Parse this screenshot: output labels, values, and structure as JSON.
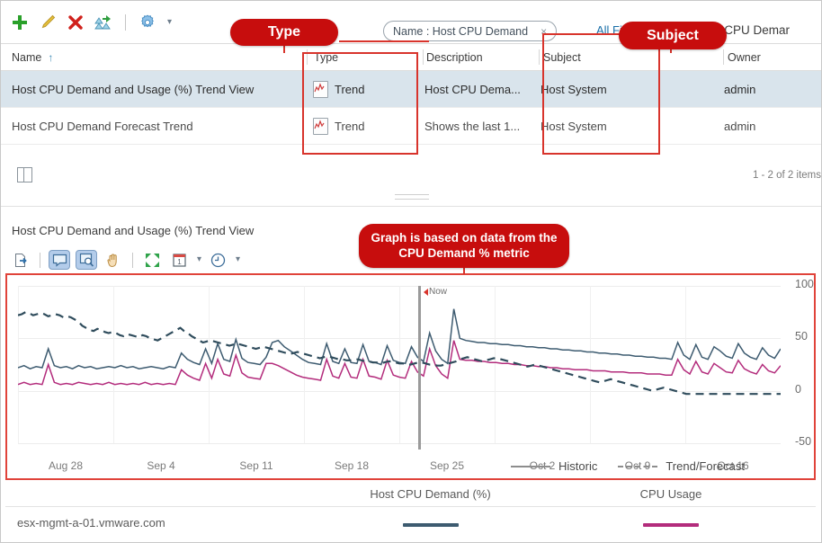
{
  "toolbar": {
    "icons": [
      {
        "name": "add-icon",
        "glyph": "+"
      },
      {
        "name": "edit-pencil-icon",
        "glyph": "/"
      },
      {
        "name": "delete-icon",
        "glyph": "X"
      },
      {
        "name": "clone-icon",
        "glyph": "clone"
      },
      {
        "name": "gear-icon",
        "glyph": "gear"
      }
    ],
    "filter_chip": "Name : Host CPU Demand",
    "filter_chip_close": "×",
    "all_filters_label": "All Fi",
    "breadcrumb_tail": "st CPU Demar"
  },
  "table": {
    "columns": [
      "Name",
      "Type",
      "Description",
      "Subject",
      "Owner"
    ],
    "sort_indicator": "↑",
    "rows": [
      {
        "name": "Host CPU Demand and Usage (%) Trend View",
        "type": "Trend",
        "description": "Host CPU Dema...",
        "subject": "Host System",
        "owner": "admin",
        "selected": true
      },
      {
        "name": "Host CPU Demand Forecast Trend",
        "type": "Trend",
        "description": "Shows the last 1...",
        "subject": "Host System",
        "owner": "admin",
        "selected": false
      }
    ],
    "pagination": "1 - 2 of 2 items"
  },
  "panel": {
    "title": "Host CPU Demand and Usage (%) Trend View",
    "tools": [
      {
        "name": "export-icon",
        "active": false
      },
      {
        "name": "tooltip-select-icon",
        "active": true
      },
      {
        "name": "zoom-select-icon",
        "active": true
      },
      {
        "name": "pan-hand-icon",
        "active": false
      },
      {
        "name": "fit-screen-icon",
        "active": false
      },
      {
        "name": "date-range-icon",
        "active": false
      },
      {
        "name": "time-range-icon",
        "active": false
      }
    ]
  },
  "chart_data": {
    "type": "line",
    "title": "Host CPU Demand and Usage (%) Trend View",
    "xlabel": "",
    "ylabel": "",
    "ylim": [
      -50,
      100
    ],
    "yticks": [
      100,
      50,
      0,
      -50
    ],
    "xticks": [
      "Aug 28",
      "Sep 4",
      "Sep 11",
      "Sep 18",
      "Sep 25",
      "Oct 2",
      "Oct 9",
      "Oct 16"
    ],
    "grid": true,
    "now_marker": "Now",
    "legend_position": "bottom-right",
    "legend": [
      {
        "label": "Historic",
        "style": "solid"
      },
      {
        "label": "Trend/Forecast",
        "style": "dashed"
      }
    ],
    "series": [
      {
        "name": "Host CPU Demand (%)",
        "color": "#3d5b70",
        "style": "solid",
        "values": [
          22,
          24,
          21,
          23,
          22,
          40,
          24,
          22,
          23,
          21,
          24,
          22,
          23,
          21,
          22,
          23,
          22,
          24,
          22,
          23,
          21,
          22,
          23,
          22,
          21,
          23,
          22,
          36,
          30,
          27,
          25,
          40,
          26,
          45,
          30,
          28,
          49,
          31,
          27,
          26,
          25,
          32,
          46,
          48,
          42,
          38,
          34,
          30,
          27,
          26,
          25,
          45,
          28,
          26,
          40,
          27,
          26,
          44,
          28,
          27,
          25,
          43,
          29,
          27,
          26,
          42,
          32,
          28,
          55,
          38,
          30,
          26,
          78,
          50,
          48,
          47,
          46,
          46,
          45,
          45,
          44,
          44,
          43,
          43,
          42,
          42,
          41,
          41,
          40,
          40,
          39,
          39,
          38,
          38,
          37,
          37,
          36,
          36,
          35,
          35,
          34,
          34,
          33,
          33,
          32,
          32,
          31,
          31,
          30,
          46,
          34,
          30,
          44,
          32,
          30,
          42,
          38,
          33,
          31,
          45,
          36,
          32,
          30,
          41,
          34,
          31,
          40
        ]
      },
      {
        "name": "CPU Usage",
        "color": "#b32c7c",
        "style": "solid",
        "values": [
          6,
          8,
          6,
          7,
          6,
          25,
          8,
          6,
          7,
          6,
          8,
          7,
          6,
          7,
          6,
          8,
          6,
          7,
          6,
          7,
          6,
          8,
          6,
          7,
          6,
          7,
          6,
          20,
          15,
          12,
          10,
          26,
          12,
          30,
          16,
          14,
          34,
          17,
          13,
          12,
          11,
          26,
          26,
          24,
          21,
          18,
          15,
          13,
          12,
          11,
          10,
          30,
          14,
          12,
          26,
          13,
          12,
          30,
          14,
          13,
          11,
          29,
          15,
          13,
          12,
          28,
          18,
          14,
          40,
          24,
          16,
          12,
          48,
          30,
          29,
          29,
          28,
          28,
          27,
          27,
          26,
          26,
          25,
          25,
          24,
          24,
          23,
          23,
          22,
          22,
          21,
          21,
          20,
          20,
          20,
          19,
          19,
          19,
          18,
          18,
          18,
          17,
          17,
          17,
          16,
          16,
          16,
          15,
          15,
          30,
          20,
          16,
          28,
          18,
          16,
          26,
          22,
          18,
          17,
          29,
          21,
          18,
          16,
          25,
          19,
          17,
          24
        ]
      },
      {
        "name": "Trend/Forecast",
        "color": "#2f4c5c",
        "style": "dashed",
        "values": [
          72,
          73,
          75,
          74,
          72,
          73,
          74,
          73,
          71,
          72,
          73,
          72,
          70,
          71,
          70,
          68,
          66,
          62,
          60,
          58,
          57,
          59,
          58,
          56,
          55,
          56,
          55,
          53,
          52,
          54,
          53,
          52,
          51,
          53,
          52,
          50,
          49,
          48,
          50,
          52,
          54,
          56,
          58,
          60,
          57,
          55,
          52,
          50,
          48,
          46,
          47,
          48,
          47,
          46,
          45,
          44,
          43,
          44,
          45,
          44,
          43,
          42,
          41,
          40,
          41,
          42,
          41,
          40,
          39,
          38,
          37,
          36,
          35,
          36,
          37,
          36,
          35,
          34,
          33,
          32,
          31,
          32,
          33,
          32,
          31,
          30,
          30,
          29,
          29,
          30,
          30,
          29,
          28,
          28,
          27,
          27,
          26,
          27,
          28,
          28,
          27,
          26,
          26,
          25,
          25,
          26,
          27,
          27,
          26,
          25,
          25,
          24,
          24,
          25,
          26,
          27,
          28,
          30,
          31,
          32,
          31,
          30,
          29,
          28,
          29,
          30,
          31,
          31,
          30,
          29,
          28,
          27,
          26,
          25,
          24,
          23,
          24,
          25,
          24,
          23,
          22,
          21,
          20,
          19,
          18,
          17,
          16,
          15,
          14,
          13,
          12,
          11,
          10,
          9,
          8,
          9,
          10,
          11,
          10,
          9,
          8,
          7,
          6,
          5,
          4,
          3,
          2,
          1,
          0,
          1,
          2,
          3,
          2,
          1,
          0,
          -1,
          -2,
          -3,
          -3,
          -3,
          -3,
          -3,
          -3,
          -3,
          -3,
          -3,
          -3,
          -3,
          -3,
          -3,
          -3,
          -3,
          -3,
          -3,
          -3,
          -3,
          -3,
          -3,
          -3,
          -3,
          -3,
          -3,
          -3
        ]
      }
    ]
  },
  "metric_legend": {
    "headers": [
      "",
      "Host CPU Demand (%)",
      "CPU Usage"
    ],
    "row_label": "esx-mgmt-a-01.vmware.com",
    "swatches": [
      "#3d5b70",
      "#b32c7c"
    ]
  },
  "annotations": {
    "callouts": [
      {
        "name": "type-callout",
        "text": "Type"
      },
      {
        "name": "subject-callout",
        "text": "Subject"
      },
      {
        "name": "graph-source-callout",
        "text": "Graph is based on data from the CPU Demand % metric"
      }
    ]
  },
  "colors": {
    "annotation_red": "#d8342c",
    "callout_red": "#c70d0d",
    "demand_line": "#3d5b70",
    "usage_line": "#b32c7c",
    "selection_blue": "#d9e4ec"
  }
}
